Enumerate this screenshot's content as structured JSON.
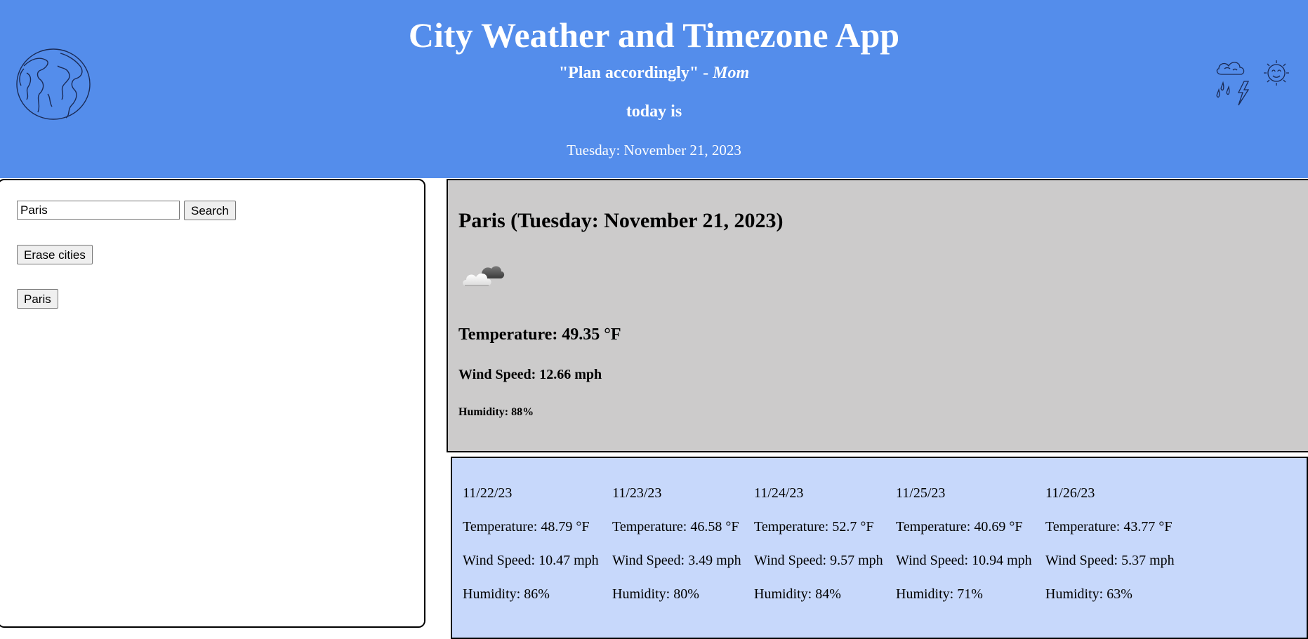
{
  "header": {
    "title": "City Weather and Timezone App",
    "quote": "\"Plan accordingly\"",
    "quote_separator": " - ",
    "quote_author": "Mom",
    "today_label": "today is",
    "today_date": "Tuesday: November 21, 2023",
    "left_art": "globe-icon",
    "right_art": "weather-doodle-icon"
  },
  "sidebar": {
    "search": {
      "value": "Paris",
      "button_label": "Search"
    },
    "erase_label": "Erase cities",
    "saved_cities": [
      "Paris"
    ]
  },
  "current": {
    "title": "Paris (Tuesday: November 21, 2023)",
    "icon": "cloud-with-dark-cloud-icon",
    "temperature": "Temperature: 49.35 °F",
    "wind": "Wind Speed: 12.66 mph",
    "humidity": "Humidity: 88%"
  },
  "forecast": [
    {
      "date": "11/22/23",
      "temp": "Temperature: 48.79 °F",
      "wind": "Wind Speed: 10.47 mph",
      "humidity": "Humidity: 86%"
    },
    {
      "date": "11/23/23",
      "temp": "Temperature: 46.58 °F",
      "wind": "Wind Speed: 3.49 mph",
      "humidity": "Humidity: 80%"
    },
    {
      "date": "11/24/23",
      "temp": "Temperature: 52.7 °F",
      "wind": "Wind Speed: 9.57 mph",
      "humidity": "Humidity: 84%"
    },
    {
      "date": "11/25/23",
      "temp": "Temperature: 40.69 °F",
      "wind": "Wind Speed: 10.94 mph",
      "humidity": "Humidity: 71%"
    },
    {
      "date": "11/26/23",
      "temp": "Temperature: 43.77 °F",
      "wind": "Wind Speed: 5.37 mph",
      "humidity": "Humidity: 63%"
    }
  ],
  "colors": {
    "header_bg": "#548deb",
    "current_bg": "#cccbcb",
    "forecast_bg": "#c7d8fb"
  }
}
